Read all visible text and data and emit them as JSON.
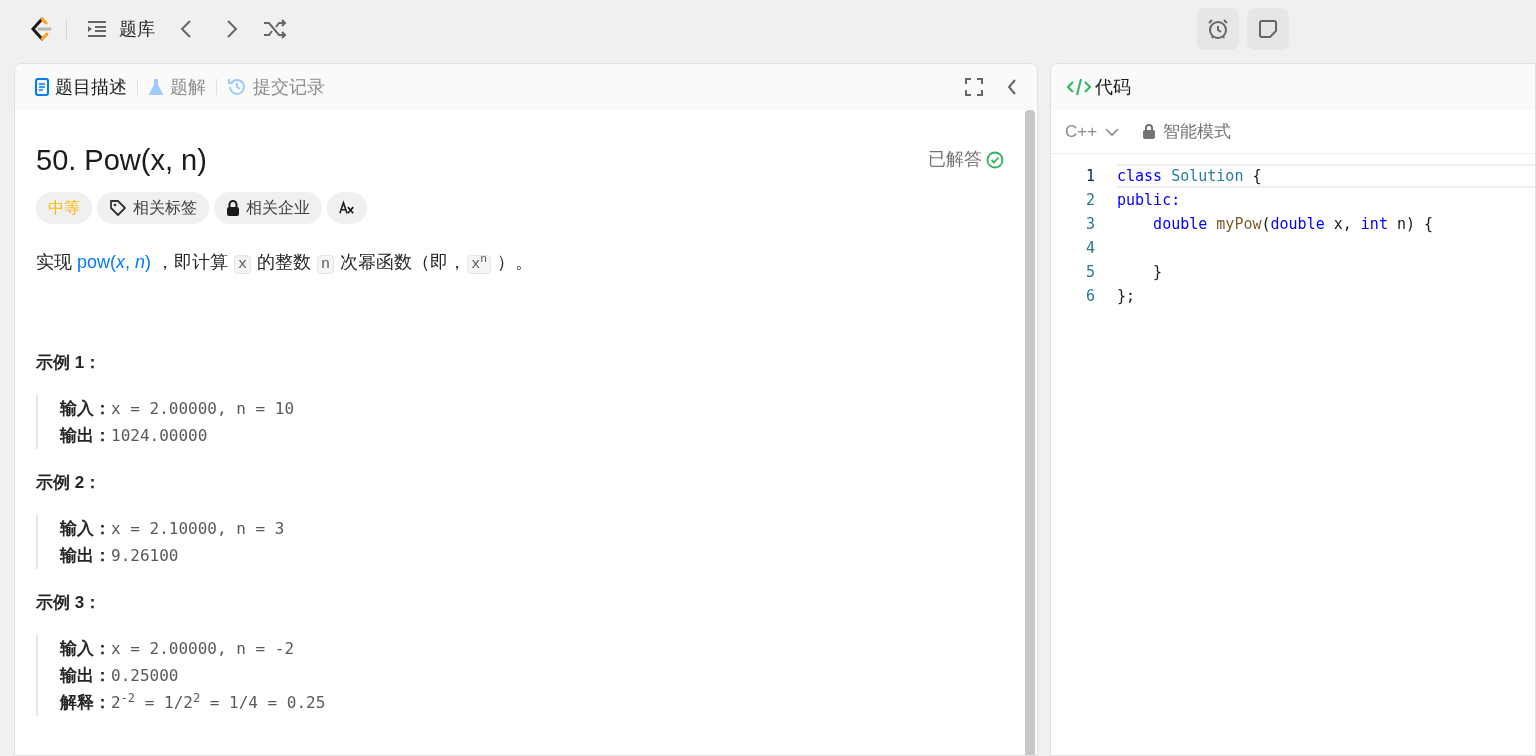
{
  "top_bar": {
    "bank_label": "题库"
  },
  "left_tabs": [
    {
      "label": "题目描述",
      "selected": true
    },
    {
      "label": "题解",
      "selected": false
    },
    {
      "label": "提交记录",
      "selected": false
    }
  ],
  "problem": {
    "title": "50. Pow(x, n)",
    "status": "已解答",
    "tags": [
      {
        "kind": "difficulty",
        "label": "中等",
        "color": "#ffb800"
      },
      {
        "kind": "tag",
        "label": "相关标签"
      },
      {
        "kind": "lock",
        "label": "相关企业"
      },
      {
        "kind": "translate"
      }
    ],
    "description": [
      {
        "kind": "text",
        "text": "实现 "
      },
      {
        "kind": "link",
        "text": "pow(*x*, *n*)"
      },
      {
        "kind": "text",
        "text": " ，即计算 "
      },
      {
        "kind": "code",
        "text": "x"
      },
      {
        "kind": "text",
        "text": " 的整数 "
      },
      {
        "kind": "code",
        "text": "n"
      },
      {
        "kind": "text",
        "text": " 次幂函数（即，"
      },
      {
        "kind": "code",
        "text": "x$^{n}$"
      },
      {
        "kind": "text",
        "text": " ）。"
      }
    ],
    "examples": [
      {
        "title": "示例 1：",
        "lines": [
          {
            "label": "输入：",
            "value": "x = 2.00000, n = 10"
          },
          {
            "label": "输出：",
            "value": "1024.00000"
          }
        ]
      },
      {
        "title": "示例 2：",
        "lines": [
          {
            "label": "输入：",
            "value": "x = 2.10000, n = 3"
          },
          {
            "label": "输出：",
            "value": "9.26100"
          }
        ]
      },
      {
        "title": "示例 3：",
        "lines": [
          {
            "label": "输入：",
            "value": "x = 2.00000, n = -2"
          },
          {
            "label": "输出：",
            "value": "0.25000"
          },
          {
            "label": "解释：",
            "value": "2$^{-2}$ = 1/2$^{2}$ = 1/4 = 0.25"
          }
        ]
      }
    ]
  },
  "code_panel": {
    "title": "代码",
    "language": "C++",
    "mode": "智能模式",
    "lines": [
      {
        "number": "1",
        "tokens": [
          {
            "kind": "keyword",
            "text": "class"
          },
          {
            "kind": "type",
            "text": " Solution"
          },
          {
            "kind": "plain",
            "text": " {"
          }
        ]
      },
      {
        "number": "2",
        "tokens": [
          {
            "kind": "keyword",
            "text": "public:"
          }
        ]
      },
      {
        "number": "3",
        "tokens": [
          {
            "kind": "keyword",
            "text": "    double"
          },
          {
            "kind": "func",
            "text": " myPow"
          },
          {
            "kind": "plain",
            "text": "("
          },
          {
            "kind": "keyword",
            "text": "double"
          },
          {
            "kind": "plain",
            "text": " x, "
          },
          {
            "kind": "keyword",
            "text": "int"
          },
          {
            "kind": "plain",
            "text": " n) {"
          }
        ]
      },
      {
        "number": "4"
      },
      {
        "number": "5",
        "tokens": [
          {
            "kind": "plain",
            "text": "    }"
          }
        ]
      },
      {
        "number": "6",
        "tokens": [
          {
            "kind": "plain",
            "text": "};"
          }
        ]
      }
    ]
  }
}
